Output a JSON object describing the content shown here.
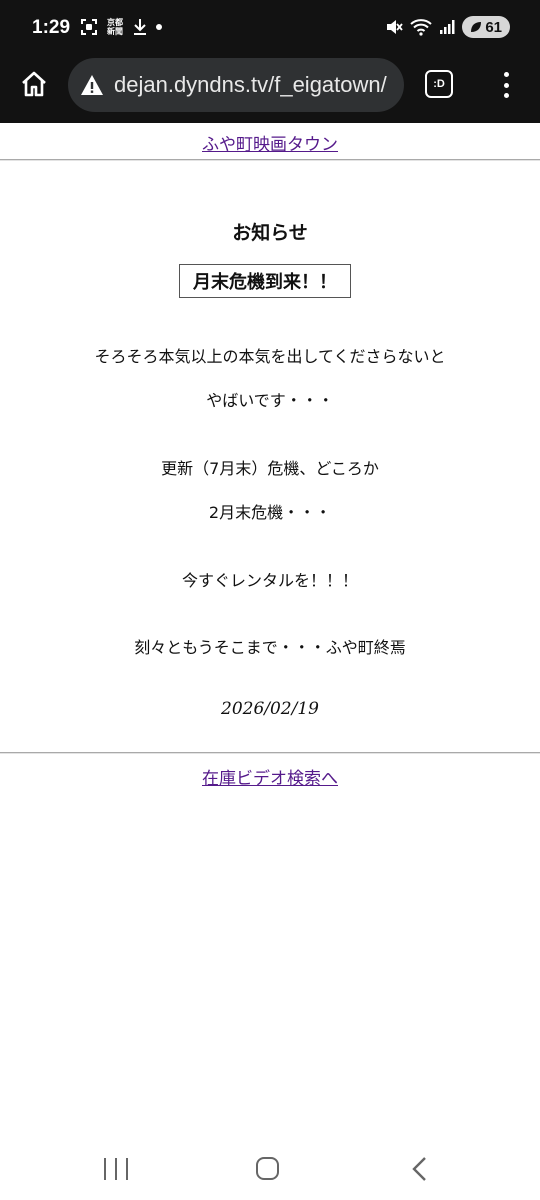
{
  "status_bar": {
    "time": "1:29",
    "news_line1": "京都",
    "news_line2": "新聞",
    "battery": "61"
  },
  "browser": {
    "url": "dejan.dyndns.tv/f_eigatown/",
    "tab_label": ":D"
  },
  "page": {
    "top_link": "ふや町映画タウン",
    "heading": "お知らせ",
    "alert": "月末危機到来！！",
    "lines": [
      "そろそろ本気以上の本気を出してくださらないと",
      "やばいです・・・",
      "更新（7月末）危機、どころか",
      "2月末危機・・・",
      "今すぐレンタルを！！！",
      "刻々ともうそこまで・・・ふや町終焉"
    ],
    "date": "2026/02/19",
    "bottom_link": "在庫ビデオ検索へ"
  },
  "icons": {
    "home": "home-icon",
    "warning": "warning-icon",
    "menu": "more-vert-icon"
  }
}
